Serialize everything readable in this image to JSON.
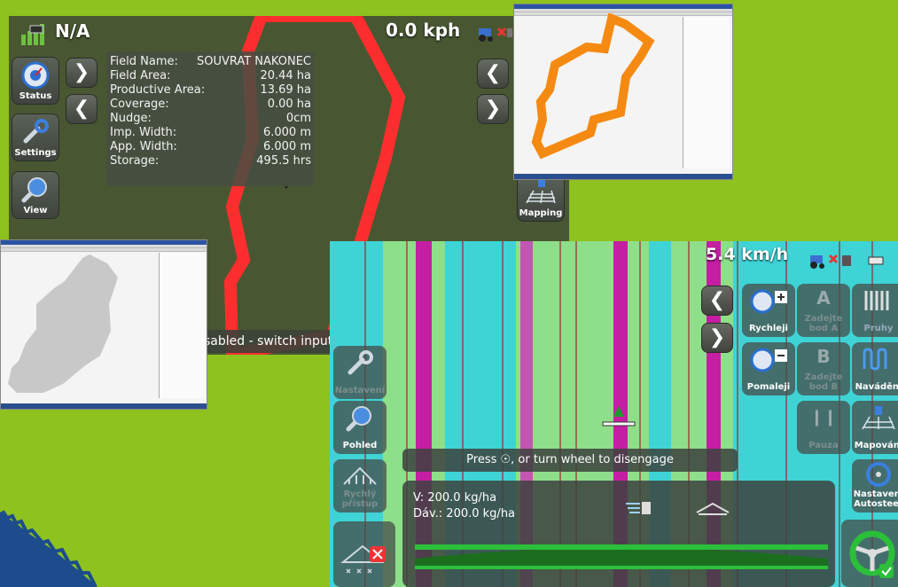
{
  "screen1": {
    "gps_status": "N/A",
    "speed": "0.0 kph",
    "buttons": {
      "status": "Status",
      "settings": "Settings",
      "view": "View",
      "mapping": "Mapping"
    },
    "field_info": [
      {
        "label": "Field Name:",
        "value": "SOUVRAT NAKONEC"
      },
      {
        "label": "Field Area:",
        "value": "20.44 ha"
      },
      {
        "label": "Productive Area:",
        "value": "13.69 ha"
      },
      {
        "label": "Coverage:",
        "value": "0.00 ha"
      },
      {
        "label": "Nudge:",
        "value": "0cm"
      },
      {
        "label": "Imp. Width:",
        "value": "6.000 m"
      },
      {
        "label": "App. Width:",
        "value": "6.000 m"
      },
      {
        "label": "Storage:",
        "value": "495.5 hrs"
      }
    ],
    "message": "sabled - switch input device is disconnected.",
    "colors": {
      "boundary": "#ff2e2e",
      "background": "#485731"
    }
  },
  "screen2": {
    "speed": "5.4 km/h",
    "buttons": {
      "faster": "Rychleji",
      "slower": "Pomaleji",
      "point_a": "Zadejte bod A",
      "point_b": "Zadejte bod B",
      "pause": "Pauza",
      "guidance": "Navádění",
      "mapping": "Mapování",
      "autosteer_settings": "Nastavení Autosteer",
      "settings": "Nastavení",
      "view": "Pohled",
      "quick_access": "Rychlý přístup",
      "lanes": "Pruhy"
    },
    "disengage_prefix": "Press ",
    "disengage_suffix": ", or turn wheel to disengage",
    "rate_v": "V: 200.0 kg/ha",
    "rate_dav": "Dáv.: 200.0 kg/ha",
    "colors": {
      "background": "#3ed4d6",
      "stripe": "#c41fa2"
    }
  }
}
